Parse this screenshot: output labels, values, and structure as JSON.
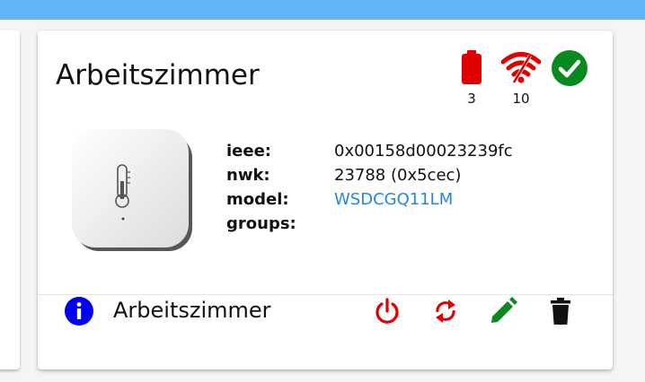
{
  "card": {
    "title": "Arbeitszimmer",
    "battery": {
      "value": "3",
      "color": "#e00000",
      "icon": "battery-icon"
    },
    "link_quality": {
      "value": "10",
      "color": "#e00000",
      "icon": "wifi-icon"
    },
    "availability": {
      "icon": "check-circle-icon",
      "color": "#0a8a1e"
    },
    "properties": [
      {
        "key": "ieee:",
        "value": "0x00158d00023239fc",
        "link": false
      },
      {
        "key": "nwk:",
        "value": "23788 (0x5cec)",
        "link": false
      },
      {
        "key": "model:",
        "value": "WSDCGQ11LM",
        "link": true
      },
      {
        "key": "groups:",
        "value": "",
        "link": false
      }
    ],
    "footer": {
      "name": "Arbeitszimmer",
      "info_color": "#0000ee",
      "actions": [
        {
          "name": "power-icon",
          "color": "#e00000"
        },
        {
          "name": "refresh-icon",
          "color": "#e00000"
        },
        {
          "name": "pencil-icon",
          "color": "#0a8a1e"
        },
        {
          "name": "trash-icon",
          "color": "#111111"
        }
      ]
    }
  }
}
